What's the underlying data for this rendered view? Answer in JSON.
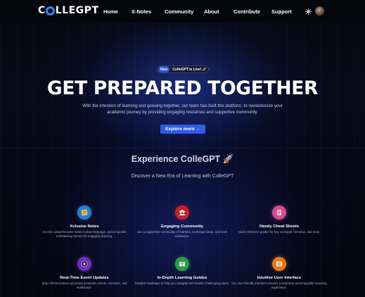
{
  "nav": {
    "logo_prefix": "C",
    "logo_suffix": "LLEGPT",
    "links": [
      "Home",
      "X-Notes",
      "Community",
      "About",
      "Contribute",
      "Support"
    ],
    "theme_icon": "sun-icon",
    "avatar_icon": "user-avatar"
  },
  "hero": {
    "badge_new": "New",
    "badge_text": "ColleGPT is Live! 🚀",
    "badge_arrow": "›",
    "title": "GET PREPARED TOGETHER",
    "description": "With the intention of learning and growing together, our team has built this platform, to revolutionize your academic journey by providing engaging resources and supportive community.",
    "cta_label": "Explore more →"
  },
  "experience": {
    "title": "Experience ColleGPT 🚀",
    "subtitle": "Discover a New Era of Learning with ColleGPT"
  },
  "features": [
    {
      "title": "Xclusive Notes",
      "description": "Access comprehensive notes in plain language, spiced up with entertaining memes for engaging learning.",
      "icon": "notes-icon",
      "color": "#2a7fd0"
    },
    {
      "title": "Engaging Community",
      "description": "Join a supportive community of learners, exchange ideas, and seek assistance.",
      "icon": "community-icon",
      "color": "#c4242a"
    },
    {
      "title": "Handy Cheat Sheets",
      "description": "Quick reference guides for key concepts, formulas, and more.",
      "icon": "cheat-sheet-icon",
      "color": "#d04f8a"
    },
    {
      "title": "Real-Time Event Updates",
      "description": "Stay informed about upcoming academic events, seminars, and workshops.",
      "icon": "event-icon",
      "color": "#6a32b8"
    },
    {
      "title": "In-Depth Learning Guides",
      "description": "Detailed roadmaps to help you navigate and master challenging topics.",
      "icon": "guide-icon",
      "color": "#2e9a4a"
    },
    {
      "title": "Intuitive User Interface",
      "description": "Our user-friendly interface ensures a seamless and enjoyable browsing experience.",
      "icon": "interface-icon",
      "color": "#e07a1a"
    }
  ],
  "colors": {
    "accent": "#2f5be8",
    "logo_ring": "#2e8bff",
    "background": "#05060a"
  }
}
